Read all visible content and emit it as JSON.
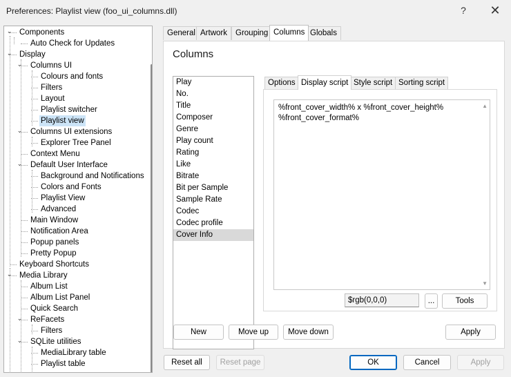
{
  "window": {
    "title": "Preferences: Playlist view (foo_ui_columns.dll)",
    "help_glyph": "?",
    "close_glyph": "✕"
  },
  "tree": {
    "items": [
      {
        "label": "Components",
        "expander": "⌄"
      },
      {
        "label": "Auto Check for Updates"
      },
      {
        "label": "Display",
        "expander": "⌄"
      },
      {
        "label": "Columns UI",
        "expander": "⌄"
      },
      {
        "label": "Colours and fonts"
      },
      {
        "label": "Filters"
      },
      {
        "label": "Layout"
      },
      {
        "label": "Playlist switcher"
      },
      {
        "label": "Playlist view",
        "selected": true
      },
      {
        "label": "Columns UI extensions",
        "expander": "⌄"
      },
      {
        "label": "Explorer Tree Panel"
      },
      {
        "label": "Context Menu"
      },
      {
        "label": "Default User Interface",
        "expander": "⌄"
      },
      {
        "label": "Background and Notifications"
      },
      {
        "label": "Colors and Fonts"
      },
      {
        "label": "Playlist View"
      },
      {
        "label": "Advanced"
      },
      {
        "label": "Main Window"
      },
      {
        "label": "Notification Area"
      },
      {
        "label": "Popup panels"
      },
      {
        "label": "Pretty Popup"
      },
      {
        "label": "Keyboard Shortcuts"
      },
      {
        "label": "Media Library",
        "expander": "⌄"
      },
      {
        "label": "Album List"
      },
      {
        "label": "Album List Panel"
      },
      {
        "label": "Quick Search"
      },
      {
        "label": "ReFacets",
        "expander": "⌄"
      },
      {
        "label": "Filters"
      },
      {
        "label": "SQLite utilities",
        "expander": "⌄"
      },
      {
        "label": "MediaLibrary table"
      },
      {
        "label": "Playlist table"
      }
    ]
  },
  "outer_tabs": [
    "General",
    "Artwork",
    "Grouping",
    "Columns",
    "Globals"
  ],
  "page": {
    "heading": "Columns",
    "columns": [
      "Play",
      "No.",
      "Title",
      "Composer",
      "Genre",
      "Play count",
      "Rating",
      "Like",
      "Bitrate",
      "Bit per Sample",
      "Sample Rate",
      "Codec",
      "Codec profile",
      "Cover Info"
    ],
    "inner_tabs": [
      "Options",
      "Display script",
      "Style script",
      "Sorting script"
    ],
    "script_lines": [
      "%front_cover_width% x %front_cover_height%",
      "%front_cover_format%"
    ],
    "color_value": "$rgb(0,0,0)",
    "ellipsis_label": "...",
    "tools_label": "Tools",
    "new_label": "New",
    "move_up_label": "Move up",
    "move_down_label": "Move down",
    "apply_inner_label": "Apply"
  },
  "footer": {
    "reset_all": "Reset all",
    "reset_page": "Reset page",
    "ok": "OK",
    "cancel": "Cancel",
    "apply": "Apply"
  }
}
